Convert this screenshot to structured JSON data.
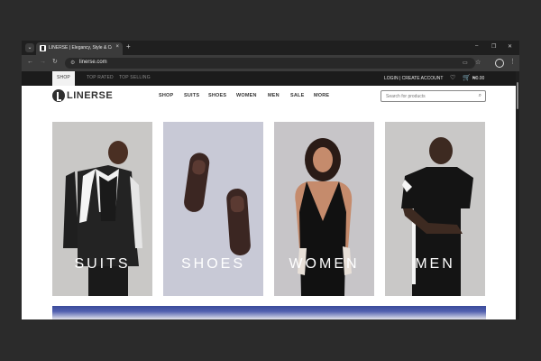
{
  "browser": {
    "tab_title": "LINERSE | Elegancy, Style & Co",
    "url": "linerse.com",
    "menu_glyph": "⌄",
    "close_glyph": "×",
    "new_tab_glyph": "+",
    "win_min": "–",
    "win_max": "❐",
    "win_close": "✕",
    "back_glyph": "←",
    "forward_glyph": "→",
    "reload_glyph": "↻",
    "site_info_glyph": "⚙",
    "cast_glyph": "▭",
    "star_glyph": "☆",
    "kebab_glyph": "⋮"
  },
  "topbar": {
    "items": [
      "SHOP",
      "TOP RATED",
      "TOP SELLING"
    ],
    "account": "LOGIN | CREATE ACCOUNT",
    "heart_glyph": "♡",
    "cart_glyph": "🛒",
    "cart_total": "₦0.00"
  },
  "header": {
    "logo": "LINERSE",
    "nav": [
      "SHOP",
      "SUITS",
      "SHOES",
      "WOMEN",
      "MEN",
      "SALE",
      "MORE"
    ],
    "search_placeholder": "Search for products",
    "search_glyph": "⌕"
  },
  "categories": [
    {
      "label": "SUITS",
      "bg": "#c9c8c6"
    },
    {
      "label": "SHOES",
      "bg": "#c8c9d6"
    },
    {
      "label": "WOMEN",
      "bg": "#c7c5c8"
    },
    {
      "label": "MEN",
      "bg": "#c9c8c7"
    }
  ],
  "colors": {
    "banner": "#3b4b9a"
  }
}
